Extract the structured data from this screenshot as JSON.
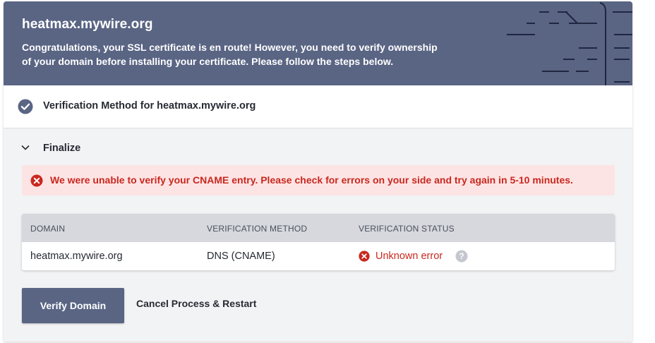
{
  "header": {
    "title": "heatmax.mywire.org",
    "message_line1": "Congratulations, your SSL certificate is en route! However, you need to verify ownership",
    "message_line2": "of your domain before installing your certificate. Please follow the steps below."
  },
  "method_step": {
    "label": "Verification Method for heatmax.mywire.org",
    "completed": true
  },
  "finalize": {
    "label": "Finalize",
    "expanded": true,
    "alert": "We were unable to verify your CNAME entry. Please check for errors on your side and try again in 5-10 minutes."
  },
  "table": {
    "columns": [
      "DOMAIN",
      "VERIFICATION METHOD",
      "VERIFICATION STATUS"
    ],
    "rows": [
      {
        "domain": "heatmax.mywire.org",
        "method": "DNS (CNAME)",
        "status": "Unknown error"
      }
    ]
  },
  "actions": {
    "verify_label": "Verify Domain",
    "cancel_label": "Cancel Process & Restart"
  },
  "colors": {
    "header_bg": "#5a6584",
    "error": "#c9281f",
    "alert_bg": "#fde4e4"
  },
  "icons": [
    "check-circle-icon",
    "chevron-down-icon",
    "error-circle-icon",
    "help-circle-icon"
  ]
}
